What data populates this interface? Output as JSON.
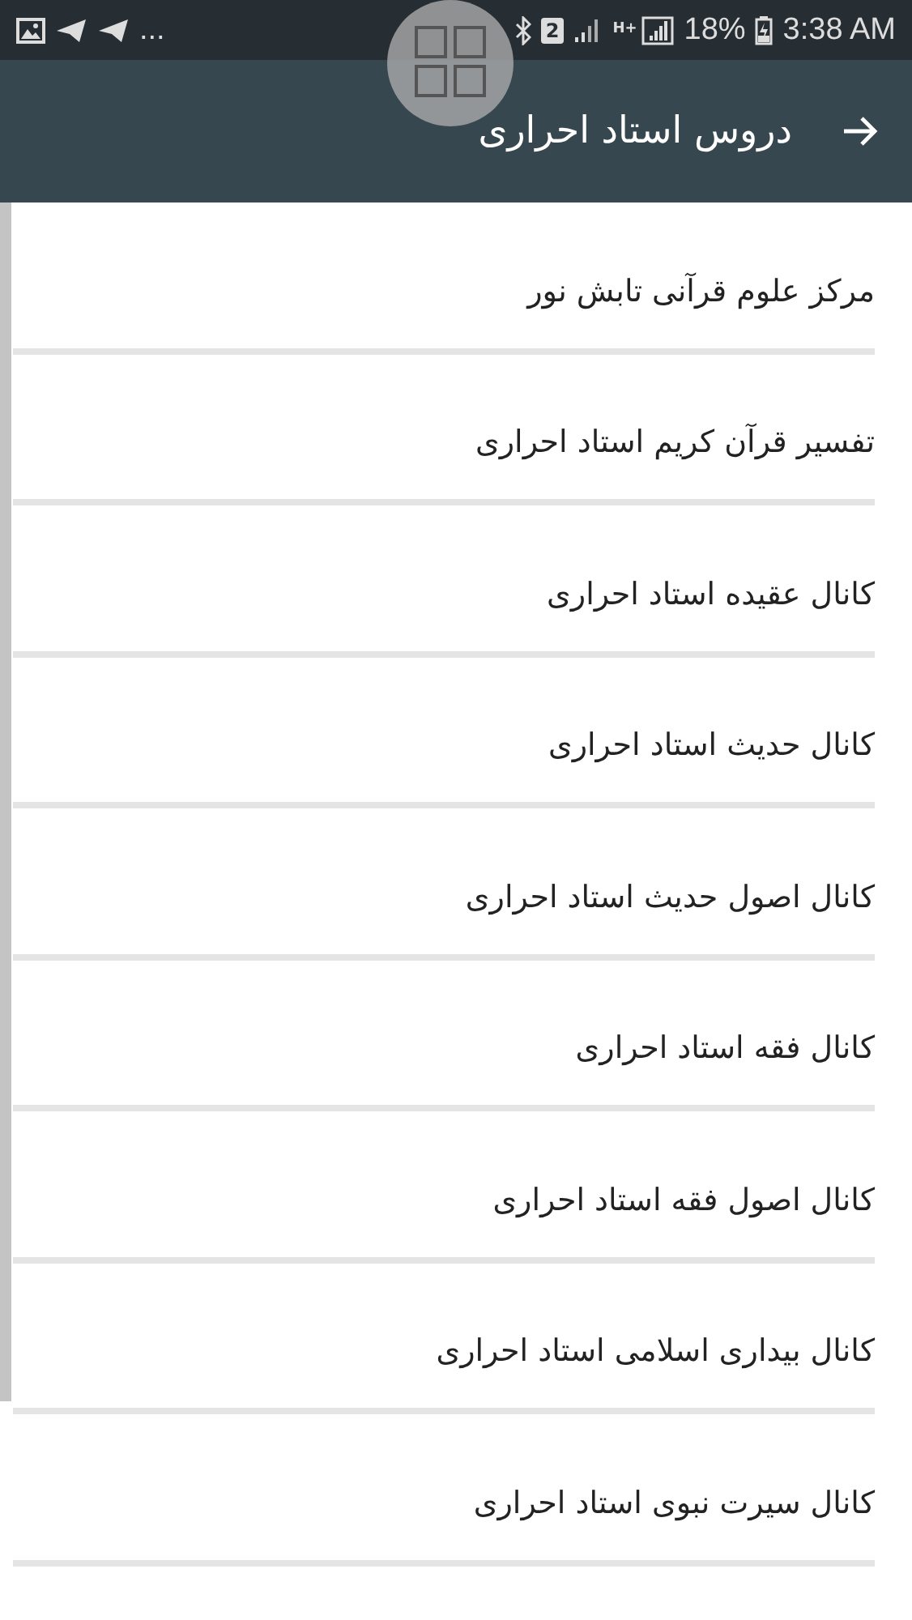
{
  "status_bar": {
    "more": "...",
    "sim_slot": "2",
    "network_type": "H+",
    "battery_percent": "18%",
    "time": "3:38 AM"
  },
  "app_bar": {
    "title": "دروس استاد احراری"
  },
  "items": [
    {
      "label": "مرکز علوم قرآنی تابش نور"
    },
    {
      "label": "تفسیر قرآن کریم استاد احراری"
    },
    {
      "label": "کانال عقیده استاد احراری"
    },
    {
      "label": "کانال حدیث استاد احراری"
    },
    {
      "label": "کانال اصول حدیث استاد احراری"
    },
    {
      "label": "کانال فقه استاد احراری"
    },
    {
      "label": "کانال اصول فقه استاد احراری"
    },
    {
      "label": "کانال بیداری اسلامی استاد احراری"
    },
    {
      "label": "کانال سیرت نبوی استاد احراری"
    }
  ]
}
